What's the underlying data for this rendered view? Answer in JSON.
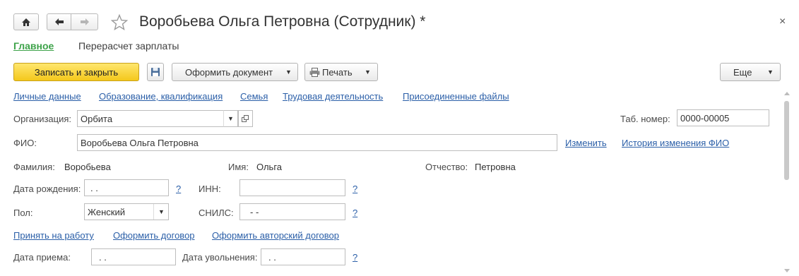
{
  "window": {
    "title": "Воробьева Ольга Петровна (Сотрудник) *",
    "home_icon": "home-icon",
    "back_icon": "arrow-left-icon",
    "forward_icon": "arrow-right-icon",
    "favorite_icon": "star-icon",
    "close_glyph": "×"
  },
  "sections": {
    "main": "Главное",
    "recalc": "Перерасчет зарплаты"
  },
  "toolbar": {
    "save_close": "Записать и закрыть",
    "create_document": "Оформить документ",
    "print": "Печать",
    "more": "Еще"
  },
  "links": {
    "personal": "Личные данные",
    "education": "Образование, квалификация",
    "family": "Семья",
    "work": "Трудовая деятельность",
    "files": "Присоединенные файлы"
  },
  "form": {
    "org_label": "Организация:",
    "org_value": "Орбита",
    "tab_label": "Таб. номер:",
    "tab_value": "0000-00005",
    "fio_label": "ФИО:",
    "fio_value": "Воробьева Ольга Петровна",
    "change_link": "Изменить",
    "history_link": "История изменения ФИО",
    "last_name_label": "Фамилия:",
    "last_name_value": "Воробьева",
    "first_name_label": "Имя:",
    "first_name_value": "Ольга",
    "patronymic_label": "Отчество:",
    "patronymic_value": "Петровна",
    "birth_label": "Дата рождения:",
    "birth_value": " .  .",
    "inn_label": "ИНН:",
    "inn_value": "",
    "gender_label": "Пол:",
    "gender_value": "Женский",
    "snils_label": "СНИЛС:",
    "snils_value": "-   -",
    "hire_link": "Принять на работу",
    "contract_link": "Оформить договор",
    "author_contract_link": "Оформить авторский договор",
    "hire_date_label": "Дата приема:",
    "hire_date_value": " .  .",
    "dismiss_label": "Дата увольнения:",
    "dismiss_value": " .  .",
    "help_mark": "?"
  }
}
